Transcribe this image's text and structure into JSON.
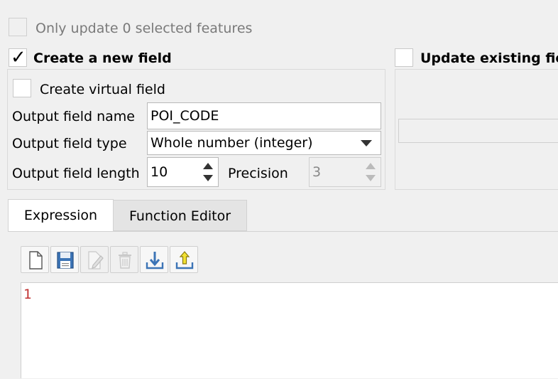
{
  "only_update": {
    "label": "Only update 0 selected features",
    "checked": false,
    "enabled": false
  },
  "create_new": {
    "label": "Create a new field",
    "checked": true,
    "virtual_field": {
      "label": "Create virtual field",
      "checked": false
    },
    "output_name": {
      "label": "Output field name",
      "value": "POI_CODE"
    },
    "output_type": {
      "label": "Output field type",
      "value": "Whole number (integer)"
    },
    "output_length": {
      "label": "Output field length",
      "value": "10"
    },
    "precision": {
      "label": "Precision",
      "value": "3"
    }
  },
  "update_existing": {
    "label": "Update existing fie",
    "checked": false
  },
  "tabs": [
    {
      "label": "Expression",
      "active": true
    },
    {
      "label": "Function Editor",
      "active": false
    }
  ],
  "toolbar": {
    "buttons": [
      {
        "icon": "new-file-icon"
      },
      {
        "icon": "save-icon"
      },
      {
        "icon": "edit-icon"
      },
      {
        "icon": "delete-icon"
      },
      {
        "icon": "import-icon"
      },
      {
        "icon": "export-icon"
      }
    ]
  },
  "editor": {
    "line_number": "1"
  },
  "colors": {
    "accent_blue": "#3c74b6",
    "tab_active": "#ffffff",
    "line_number": "#c03030"
  }
}
